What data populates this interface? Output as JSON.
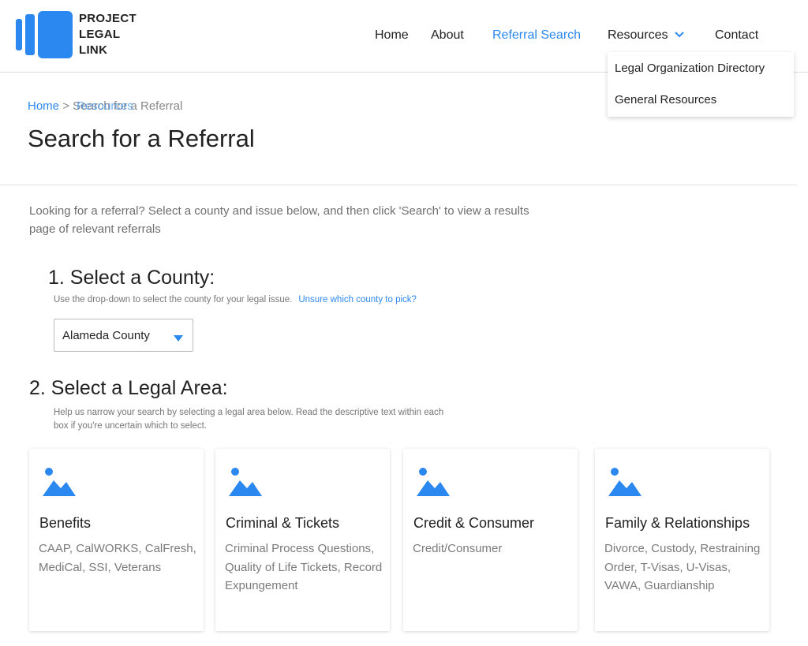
{
  "header": {
    "logo_lines": [
      "PROJECT",
      "LEGAL",
      "LINK"
    ],
    "nav": {
      "home": "Home",
      "about": "About",
      "referral_search": "Referral Search",
      "resources": "Resources",
      "contact": "Contact"
    },
    "resources_menu": [
      "Legal Organization Directory",
      "General Resources"
    ]
  },
  "breadcrumb": {
    "home": "Home",
    "separator": ">",
    "overlap_text": "Resources",
    "current": "Search for a Referral"
  },
  "page_title": "Search for a Referral",
  "intro": "Looking for a referral? Select a county and issue below, and then click 'Search' to view a results page of relevant referrals",
  "step1": {
    "heading": "1. Select a County:",
    "help": "Use the drop-down to select the county for your legal issue.",
    "help_link": "Unsure which county to pick?",
    "selected_county": "Alameda County"
  },
  "step2": {
    "heading": "2. Select a Legal Area:",
    "help": "Help us narrow your search by selecting a legal area below. Read the descriptive text within each box if you're uncertain which to select."
  },
  "cards": [
    {
      "title": "Benefits",
      "desc": "CAAP, CalWORKS, CalFresh, MediCal, SSI, Veterans"
    },
    {
      "title": "Criminal & Tickets",
      "desc": "Criminal Process Questions, Quality of Life Tickets, Record Expungement"
    },
    {
      "title": "Credit & Consumer",
      "desc": "Credit/Consumer"
    },
    {
      "title": "Family & Relationships",
      "desc": "Divorce, Custody, Restraining Order, T-Visas, U-Visas, VAWA, Guardianship"
    }
  ],
  "colors": {
    "accent": "#2b88f0",
    "text": "#222222",
    "muted": "#7a7a7a"
  }
}
